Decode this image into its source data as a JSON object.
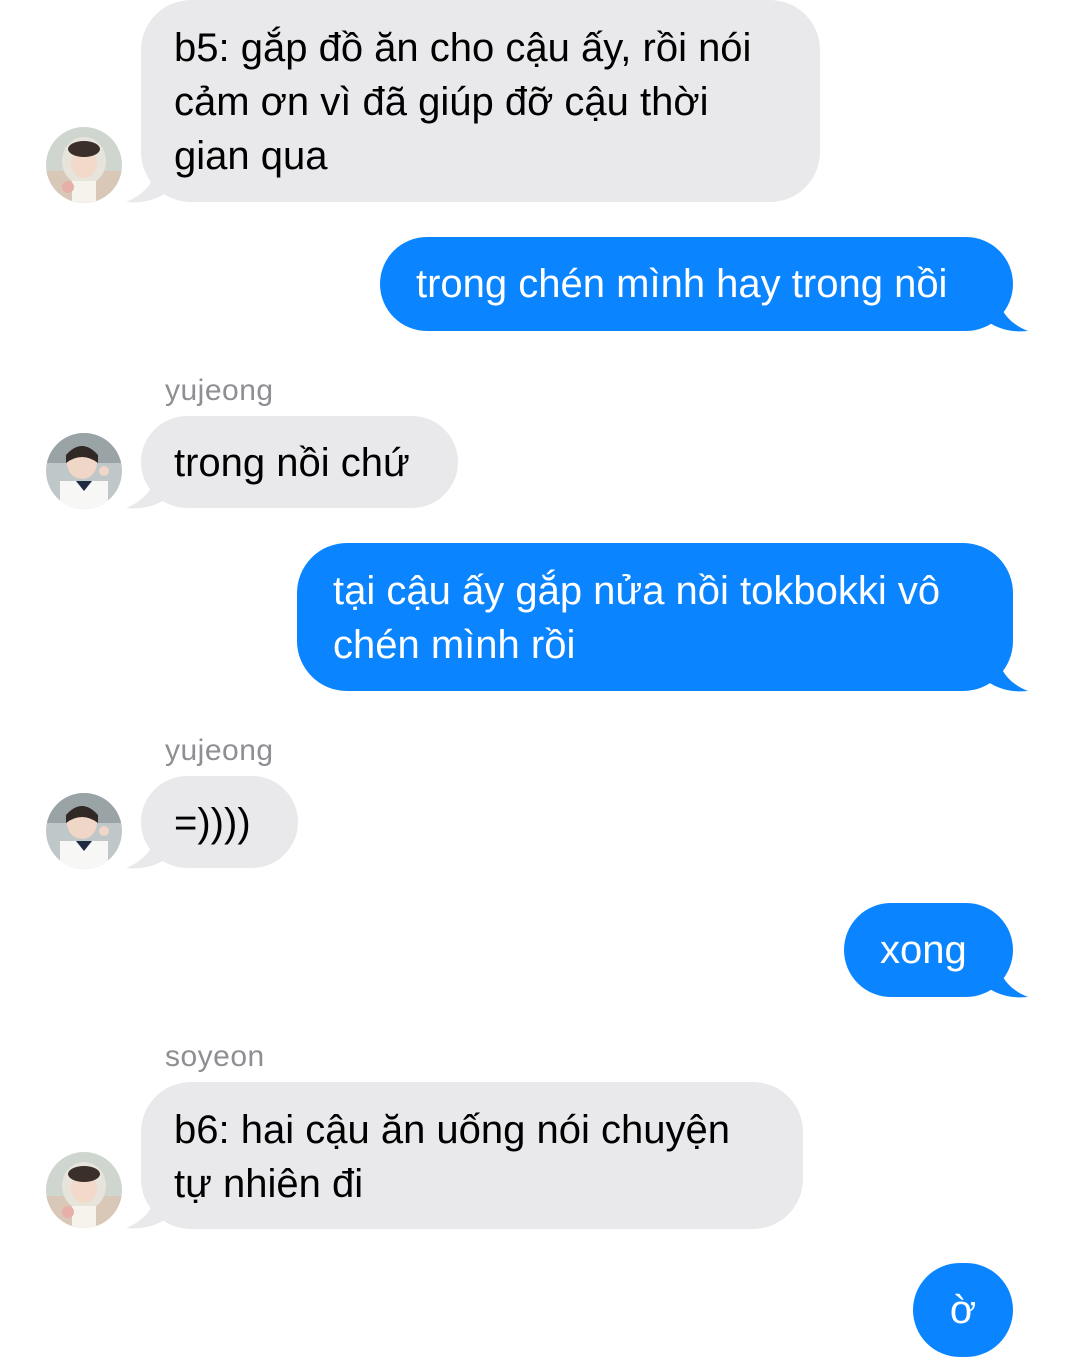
{
  "conversation": {
    "colors": {
      "incoming_bubble": "#e9e9eb",
      "outgoing_bubble": "#0a84ff",
      "incoming_text": "#000000",
      "outgoing_text": "#ffffff",
      "sender_name": "#8e8e93"
    },
    "messages": [
      {
        "direction": "incoming",
        "sender": "",
        "avatar": "photo-avatar-headscarf",
        "text": "b5: gắp đồ ăn cho cậu ấy, rồi nói cảm ơn vì đã giúp đỡ cậu thời gian qua"
      },
      {
        "direction": "outgoing",
        "text": "trong chén mình hay trong nồi"
      },
      {
        "direction": "incoming",
        "sender": "yujeong",
        "avatar": "photo-avatar-uniform",
        "text": "trong nồi chứ"
      },
      {
        "direction": "outgoing",
        "text": "tại cậu ấy gắp nửa nồi tokbokki vô chén mình rồi"
      },
      {
        "direction": "incoming",
        "sender": "yujeong",
        "avatar": "photo-avatar-uniform",
        "text": "=))))"
      },
      {
        "direction": "outgoing",
        "text": "xong"
      },
      {
        "direction": "incoming",
        "sender": "soyeon",
        "avatar": "photo-avatar-headscarf",
        "text": "b6: hai cậu ăn uống nói chuyện tự nhiên đi"
      },
      {
        "direction": "outgoing",
        "text": "ờ"
      }
    ]
  }
}
